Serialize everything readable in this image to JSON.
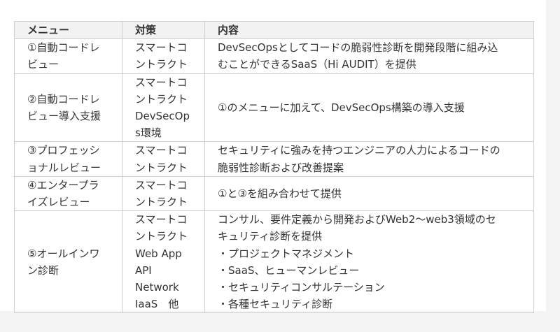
{
  "table": {
    "headers": [
      "メニュー",
      "対策",
      "内容"
    ],
    "rows": [
      {
        "menu": [
          "①自動コードレ",
          "ビュー"
        ],
        "measure": [
          "スマートコ",
          "ントラクト"
        ],
        "content": [
          "DevSecOpsとしてコードの脆弱性診断を開発段階に組み込",
          "むことができるSaaS（Hi AUDIT）を提供"
        ]
      },
      {
        "menu": [
          "②自動コードレ",
          "ビュー導入支援"
        ],
        "measure": [
          "スマートコ",
          "ントラクト",
          "DevSecOp",
          "s環境"
        ],
        "content": [
          "①のメニューに加えて、DevSecOps構築の導入支援"
        ]
      },
      {
        "menu": [
          "③プロフェッシ",
          "ョナルレビュー"
        ],
        "measure": [
          "スマートコ",
          "ントラクト"
        ],
        "content": [
          "セキュリティに強みを持つエンジニアの人力によるコードの",
          "脆弱性診断および改善提案"
        ]
      },
      {
        "menu": [
          "④エンタープラ",
          "イズレビュー"
        ],
        "measure": [
          "スマートコ",
          "ントラクト"
        ],
        "content": [
          "①と③を組み合わせて提供"
        ]
      },
      {
        "menu": [
          "⑤オールインワ",
          "ン診断"
        ],
        "measure": [
          "スマートコ",
          "ントラクト",
          "Web App",
          "API",
          "Network",
          "IaaS　他"
        ],
        "content": [
          "コンサル、要件定義から開発およびWeb2〜web3領域のセ",
          "キュリティ診断を提供",
          "・プロジェクトマネジメント",
          "・SaaS、ヒューマンレビュー",
          "・セキュリティコンサルテーション",
          "・各種セキュリティ診断"
        ]
      }
    ]
  }
}
